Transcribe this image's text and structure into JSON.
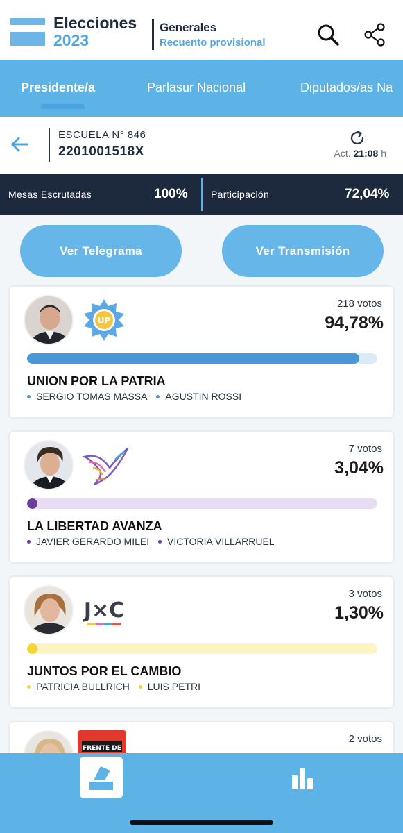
{
  "header": {
    "brand_title": "Elecciones",
    "brand_year": "2023",
    "section_title": "Generales",
    "section_subtitle": "Recuento provisional",
    "search_icon": "search-icon",
    "share_icon": "share-icon"
  },
  "tabs": [
    {
      "label": "Presidente/a",
      "active": true
    },
    {
      "label": "Parlasur Nacional",
      "active": false
    },
    {
      "label": "Diputados/as Na",
      "active": false
    }
  ],
  "location": {
    "school": "ESCUELA N° 846",
    "mesa_code": "2201001518X",
    "update_prefix": "Act.",
    "update_time": "21:08",
    "update_suffix": "h"
  },
  "stats": {
    "mesas_label": "Mesas Escrutadas",
    "mesas_value": "100%",
    "participation_label": "Participación",
    "participation_value": "72,04%"
  },
  "actions": {
    "telegram": "Ver Telegrama",
    "transmission": "Ver Transmisión"
  },
  "results": [
    {
      "votes": "218 votos",
      "percent": "94,78%",
      "share": 0.9478,
      "party": "UNION POR LA PATRIA",
      "candidates": [
        "SERGIO TOMAS MASSA",
        "AGUSTIN ROSSI"
      ],
      "color": "#4a97d8",
      "track_color": "#d9ebf8",
      "dot_color": "#4a97d8",
      "logo_text": "UP"
    },
    {
      "votes": "7 votos",
      "percent": "3,04%",
      "share": 0.0304,
      "party": "LA LIBERTAD AVANZA",
      "candidates": [
        "JAVIER GERARDO MILEI",
        "VICTORIA VILLARRUEL"
      ],
      "color": "#6a3ea1",
      "track_color": "#e6dcf3",
      "dot_color": "#6a3ea1",
      "logo_text": ""
    },
    {
      "votes": "3 votos",
      "percent": "1,30%",
      "share": 0.013,
      "party": "JUNTOS POR EL CAMBIO",
      "candidates": [
        "PATRICIA BULLRICH",
        "LUIS PETRI"
      ],
      "color": "#f4d735",
      "track_color": "#fdf4c4",
      "dot_color": "#f4d735",
      "logo_text": "J×C"
    },
    {
      "votes": "2 votos",
      "logo_text": "FRENTE DE"
    }
  ],
  "bottom_nav": {
    "home_icon": "ballot-icon",
    "stats_icon": "bar-chart-icon"
  }
}
